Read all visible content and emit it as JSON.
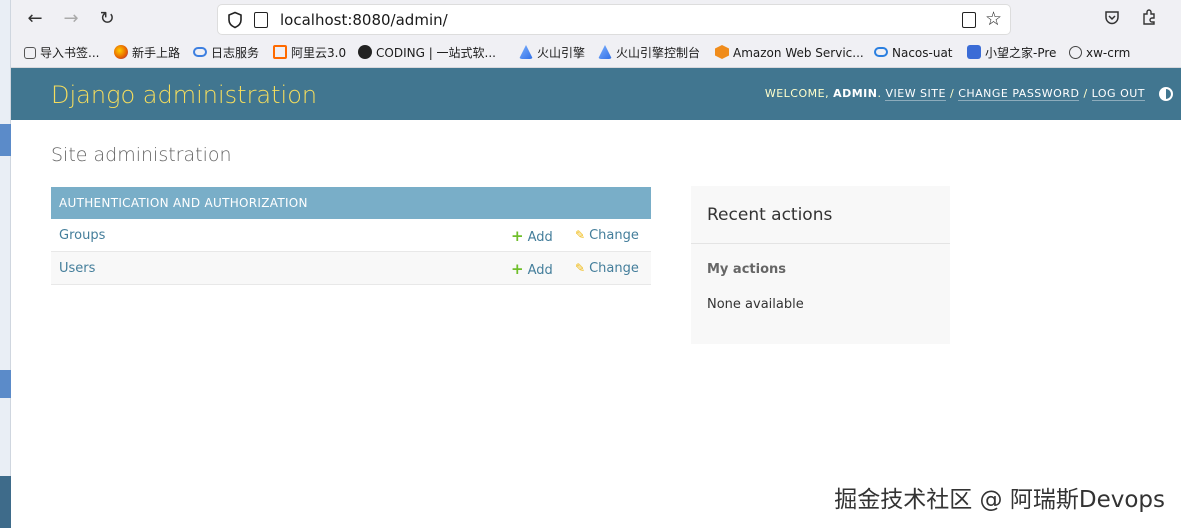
{
  "browser": {
    "url": "localhost:8080/admin/"
  },
  "bookmarks": [
    {
      "label": "导入书签...",
      "color": "#555555",
      "icon": "import-icon"
    },
    {
      "label": "新手上路",
      "color": "#e66000",
      "icon": "firefox-icon"
    },
    {
      "label": "日志服务",
      "color": "#3d7fe0",
      "icon": "cloud-icon"
    },
    {
      "label": "阿里云3.0",
      "color": "#ff6a00",
      "icon": "aliyun-icon"
    },
    {
      "label": "CODING | 一站式软...",
      "color": "#222222",
      "icon": "coding-icon"
    },
    {
      "label": "火山引擎",
      "color": "#2f6ee6",
      "icon": "volcano-icon"
    },
    {
      "label": "火山引擎控制台",
      "color": "#2f6ee6",
      "icon": "volcano-icon"
    },
    {
      "label": "Amazon Web Servic...",
      "color": "#f08c1b",
      "icon": "aws-icon"
    },
    {
      "label": "Nacos-uat",
      "color": "#2a7fe0",
      "icon": "nacos-icon"
    },
    {
      "label": "小望之家-Pre",
      "color": "#3b6cd6",
      "icon": "w-icon"
    },
    {
      "label": "xw-crm",
      "color": "#444444",
      "icon": "globe-icon"
    }
  ],
  "header": {
    "brand": "Django administration",
    "welcome": "WELCOME,",
    "user": "ADMIN",
    "view_site": "VIEW SITE",
    "change_password": "CHANGE PASSWORD",
    "log_out": "LOG OUT",
    "sep": "/"
  },
  "content": {
    "title": "Site administration",
    "module": {
      "caption": "AUTHENTICATION AND AUTHORIZATION",
      "rows": [
        {
          "name": "Groups",
          "add": "Add",
          "change": "Change"
        },
        {
          "name": "Users",
          "add": "Add",
          "change": "Change"
        }
      ]
    }
  },
  "recent": {
    "title": "Recent actions",
    "subtitle": "My actions",
    "empty": "None available"
  },
  "watermark": "掘金技术社区 @ 阿瑞斯Devops",
  "colors": {
    "header_bg": "#417690",
    "brand": "#f5dd5d",
    "caption_bg": "#79aec8",
    "link": "#447e9b",
    "add_icon": "#70bf2b",
    "change_icon": "#efb80b"
  }
}
